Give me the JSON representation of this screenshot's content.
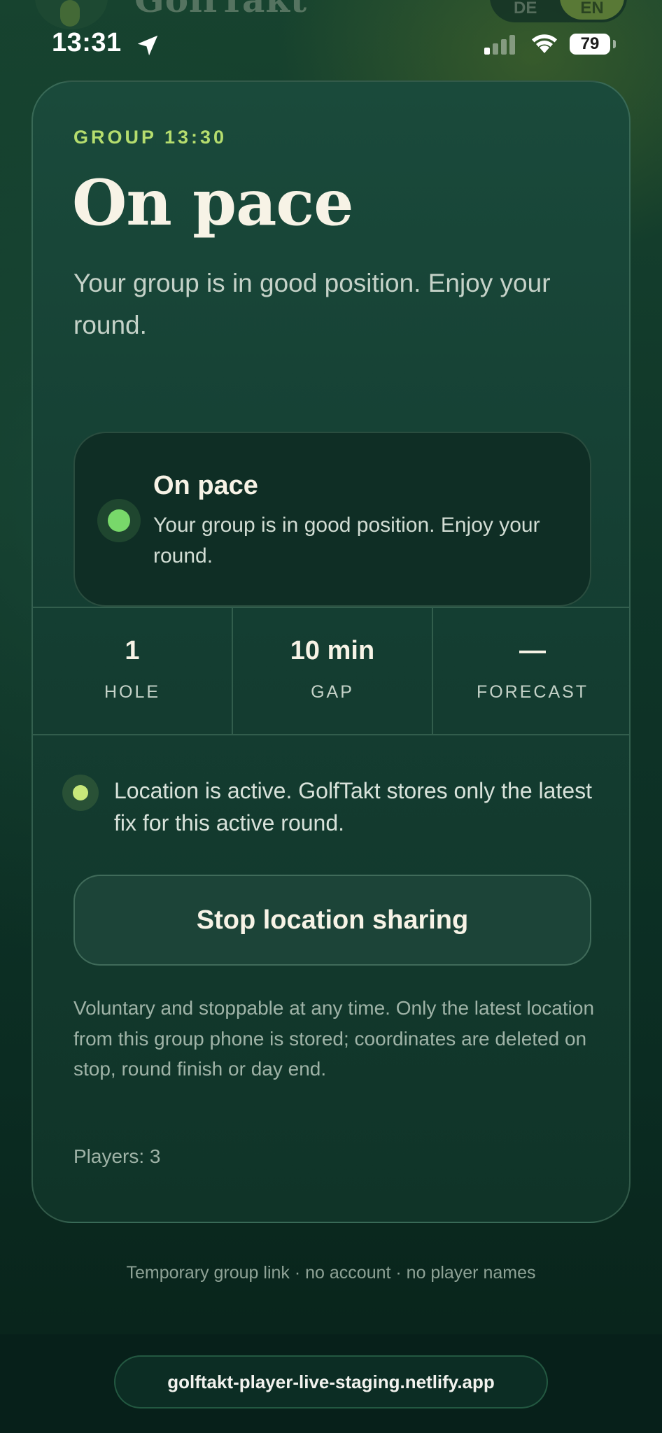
{
  "app": {
    "brand": "GolfTakt",
    "languages": [
      "DE",
      "EN"
    ],
    "active_language": "EN"
  },
  "status_bar": {
    "time": "13:31",
    "battery": "79",
    "icons": [
      "location-arrow-icon",
      "cellular-signal-icon",
      "wifi-icon",
      "battery-icon"
    ]
  },
  "card": {
    "eyebrow": "GROUP 13:30",
    "title": "On pace",
    "subtitle": "Your group is in good position. Enjoy your round.",
    "status": {
      "title": "On pace",
      "text": "Your group is in good position. Enjoy your round.",
      "color": "#78d86a"
    },
    "stats": [
      {
        "value": "1",
        "label": "HOLE"
      },
      {
        "value": "10 min",
        "label": "GAP"
      },
      {
        "value": "—",
        "label": "FORECAST"
      }
    ],
    "location_text": "Location is active. GolfTakt stores only the latest fix for this active round.",
    "stop_button": "Stop location sharing",
    "notice": "Voluntary and stoppable at any time. Only the latest location from this group phone is stored; coordinates are deleted on stop, round finish or day end.",
    "players": "Players: 3"
  },
  "footer_note": "Temporary group link · no account · no player names",
  "browser": {
    "url": "golftakt-player-live-staging.netlify.app"
  },
  "colors": {
    "accent": "#b5dd6e",
    "status_green": "#78d86a",
    "background": "#0b2a20"
  }
}
